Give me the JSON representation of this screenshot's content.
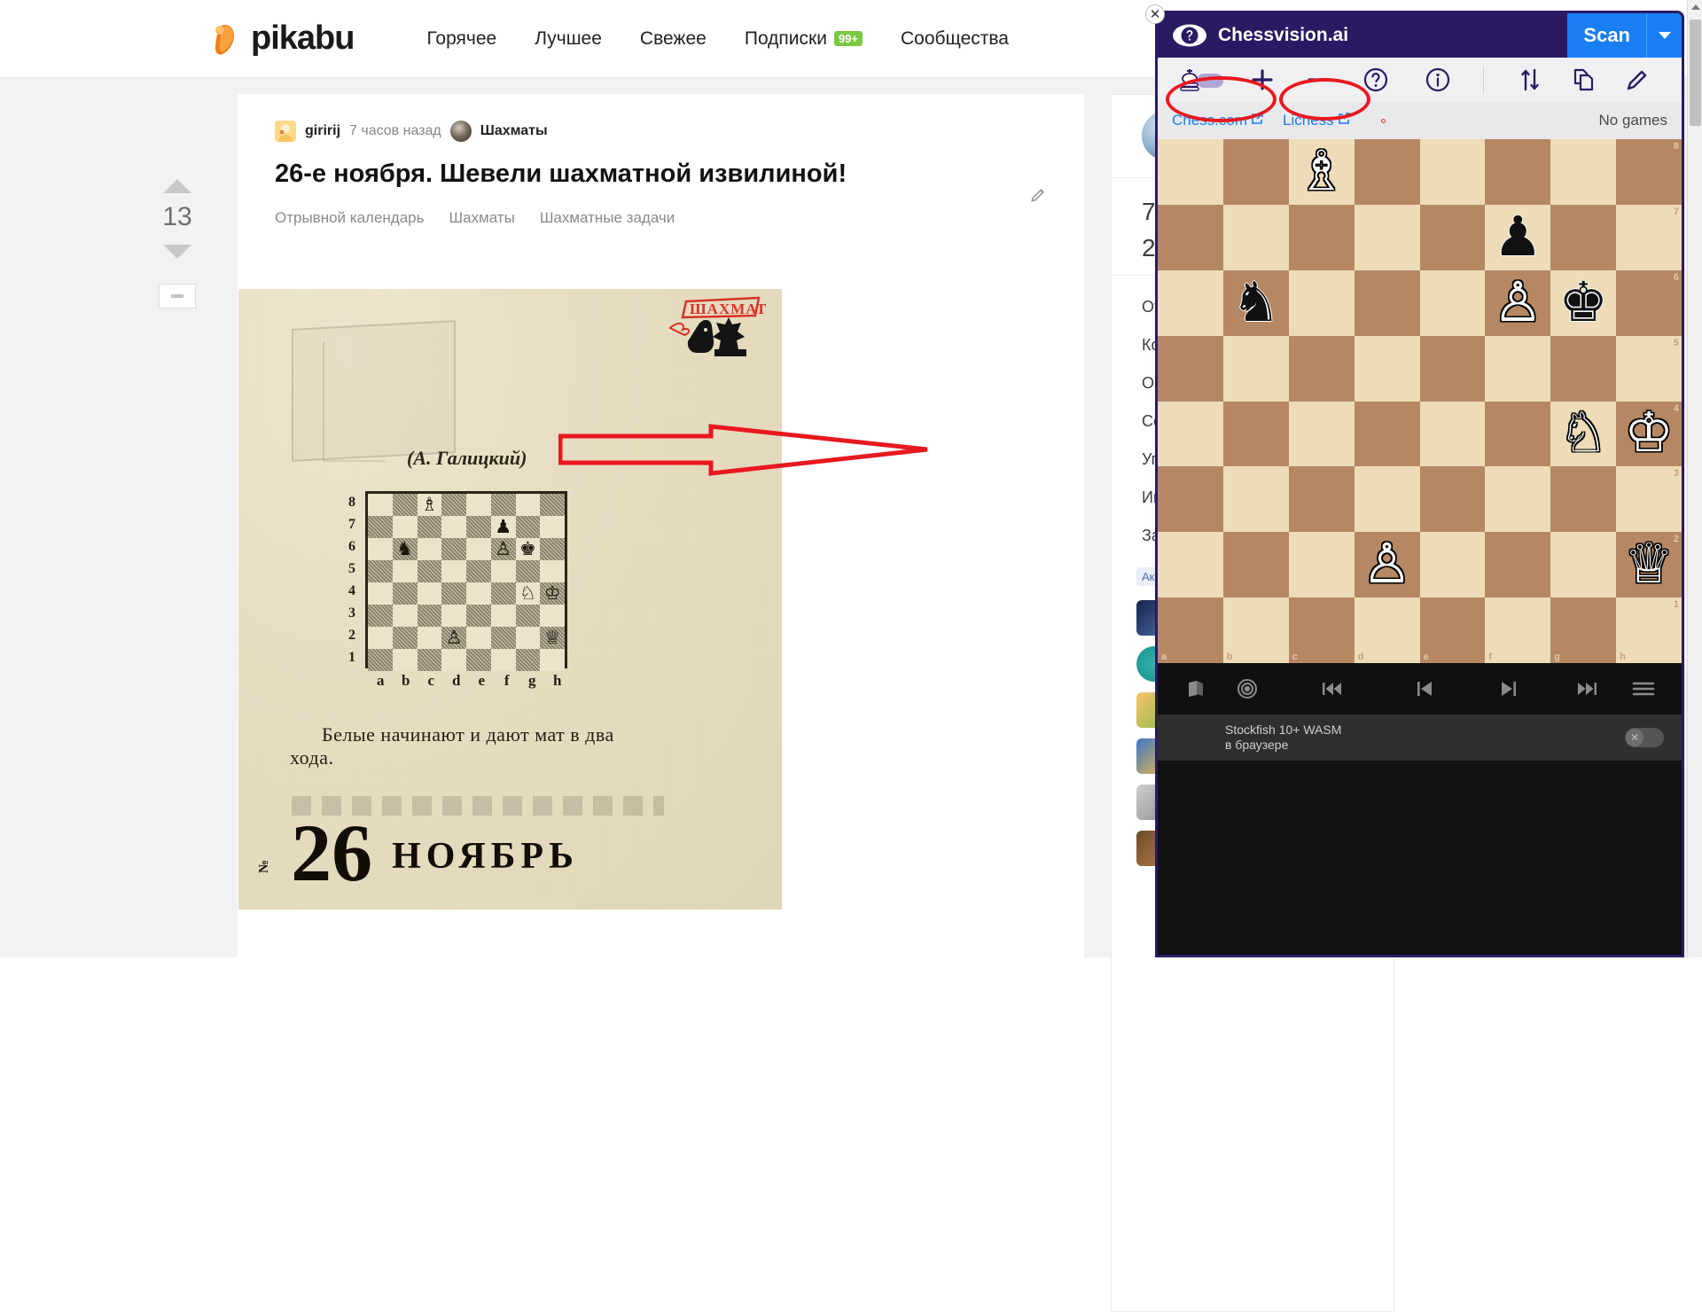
{
  "site": {
    "brand": "pikabu",
    "nav": [
      {
        "label": "Горячее"
      },
      {
        "label": "Лучшее"
      },
      {
        "label": "Свежее"
      },
      {
        "label": "Подписки",
        "badge": "99+"
      },
      {
        "label": "Сообщества"
      }
    ]
  },
  "post": {
    "vote_count": "13",
    "author": "giririj",
    "time": "7 часов назад",
    "community": "Шахматы",
    "title": "26-е ноября. Шевели шахматной извилиной!",
    "tags": [
      "Отрывной календарь",
      "Шахматы",
      "Шахматные задачи"
    ]
  },
  "scan": {
    "emblem_text": "ШАХМАТЫ",
    "author_credit": "(А. Галицкий)",
    "caption_line1": "Белые начинают и дают  мат  в  два",
    "caption_line2": "хода.",
    "big_day": "26",
    "big_month": "НОЯБРЬ",
    "corner_mark": "№",
    "ranks": [
      "8",
      "7",
      "6",
      "5",
      "4",
      "3",
      "2",
      "1"
    ],
    "files": [
      "a",
      "b",
      "c",
      "d",
      "e",
      "f",
      "g",
      "h"
    ]
  },
  "rail": {
    "stat1": "7",
    "stat2": "2",
    "links": [
      "От",
      "Ко",
      "Оп",
      "Со",
      "Уп",
      "Ин",
      "За"
    ],
    "section_label": "Ак"
  },
  "chessvision": {
    "title": "Chessvision.ai",
    "scan_button": "Scan",
    "toolbar": [
      {
        "name": "king-toggle"
      },
      {
        "name": "plus-icon"
      },
      {
        "name": "minus-icon"
      },
      {
        "name": "help-icon"
      },
      {
        "name": "info-icon"
      },
      {
        "name": "flip-board-icon"
      },
      {
        "name": "copy-icon"
      },
      {
        "name": "edit-icon"
      }
    ],
    "links": [
      {
        "label": "Chess.com"
      },
      {
        "label": "Lichess"
      }
    ],
    "games_status": "No games",
    "engine_name": "Stockfish 10+  WASM",
    "engine_sub": "в браузере",
    "engine_toggle_state": "off",
    "controls": [
      {
        "name": "book-icon"
      },
      {
        "name": "target-icon"
      },
      {
        "name": "rewind-start-icon"
      },
      {
        "name": "step-back-icon"
      },
      {
        "name": "step-forward-icon"
      },
      {
        "name": "fast-forward-end-icon"
      },
      {
        "name": "menu-icon"
      }
    ],
    "board": {
      "orientation": "white",
      "light_color": "#eedcb8",
      "dark_color": "#b58863",
      "files": [
        "a",
        "b",
        "c",
        "d",
        "e",
        "f",
        "g",
        "h"
      ],
      "ranks": [
        "8",
        "7",
        "6",
        "5",
        "4",
        "3",
        "2",
        "1"
      ],
      "fen": "2B5/5p2/1n3PK1/8/6NK/8/3P3Q/8",
      "pieces": [
        {
          "square": "c8",
          "piece": "white-bishop",
          "glyph": "♗",
          "color": "w"
        },
        {
          "square": "f7",
          "piece": "black-pawn",
          "glyph": "♟",
          "color": "b"
        },
        {
          "square": "b6",
          "piece": "black-knight",
          "glyph": "♞",
          "color": "b"
        },
        {
          "square": "f6",
          "piece": "white-pawn",
          "glyph": "♙",
          "color": "w"
        },
        {
          "square": "g6",
          "piece": "black-king",
          "glyph": "♚",
          "color": "b"
        },
        {
          "square": "g4",
          "piece": "white-knight",
          "glyph": "♘",
          "color": "w"
        },
        {
          "square": "h4",
          "piece": "white-king",
          "glyph": "♔",
          "color": "w"
        },
        {
          "square": "d2",
          "piece": "white-pawn",
          "glyph": "♙",
          "color": "w"
        },
        {
          "square": "h2",
          "piece": "white-queen",
          "glyph": "♕",
          "color": "w"
        }
      ]
    }
  },
  "newspaper_board": {
    "pieces": [
      {
        "square": "c8",
        "glyph": "♗",
        "color": "w"
      },
      {
        "square": "f7",
        "glyph": "♟",
        "color": "b"
      },
      {
        "square": "b6",
        "glyph": "♞",
        "color": "b"
      },
      {
        "square": "f6",
        "glyph": "♙",
        "color": "w"
      },
      {
        "square": "g6",
        "glyph": "♚",
        "color": "b"
      },
      {
        "square": "g4",
        "glyph": "♘",
        "color": "w"
      },
      {
        "square": "h4",
        "glyph": "♔",
        "color": "w"
      },
      {
        "square": "d2",
        "glyph": "♙",
        "color": "w"
      },
      {
        "square": "h2",
        "glyph": "♕",
        "color": "w"
      }
    ]
  },
  "annotations": {
    "arrow_color": "#e8181f",
    "ellipse_color": "#e8181f"
  }
}
